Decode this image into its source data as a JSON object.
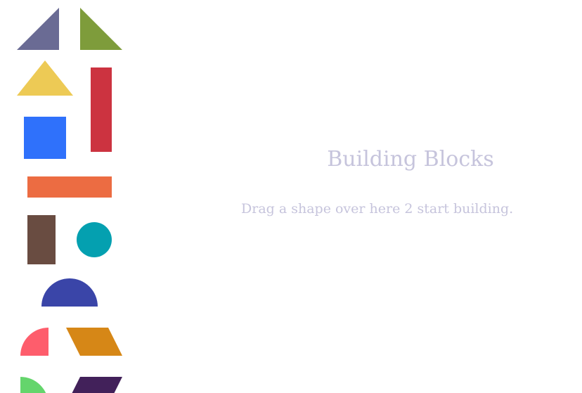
{
  "canvas": {
    "title": "Building Blocks",
    "hint": "Drag a shape over here 2 start building."
  },
  "shapes": [
    {
      "name": "slate-right-triangle-left",
      "kind": "triangle",
      "color": "#6a6b94"
    },
    {
      "name": "olive-right-triangle-right",
      "kind": "triangle",
      "color": "#7e9c3b"
    },
    {
      "name": "yellow-triangle",
      "kind": "triangle",
      "color": "#edca55"
    },
    {
      "name": "red-tall-rectangle",
      "kind": "rectangle",
      "color": "#cc3340"
    },
    {
      "name": "blue-square",
      "kind": "square",
      "color": "#2f71fb"
    },
    {
      "name": "orange-wide-rectangle",
      "kind": "rectangle",
      "color": "#ec6c42"
    },
    {
      "name": "brown-rectangle",
      "kind": "rectangle",
      "color": "#694c41"
    },
    {
      "name": "teal-circle",
      "kind": "circle",
      "color": "#04a0b0"
    },
    {
      "name": "indigo-semicircle",
      "kind": "semicircle",
      "color": "#3a45a8"
    },
    {
      "name": "pink-quarter-circle",
      "kind": "quarter-circle",
      "color": "#fe5d6c"
    },
    {
      "name": "amber-parallelogram",
      "kind": "parallelogram",
      "color": "#d68717"
    },
    {
      "name": "green-quarter-circle",
      "kind": "quarter-circle",
      "color": "#64d56c"
    },
    {
      "name": "purple-parallelogram",
      "kind": "parallelogram",
      "color": "#42215a"
    }
  ]
}
